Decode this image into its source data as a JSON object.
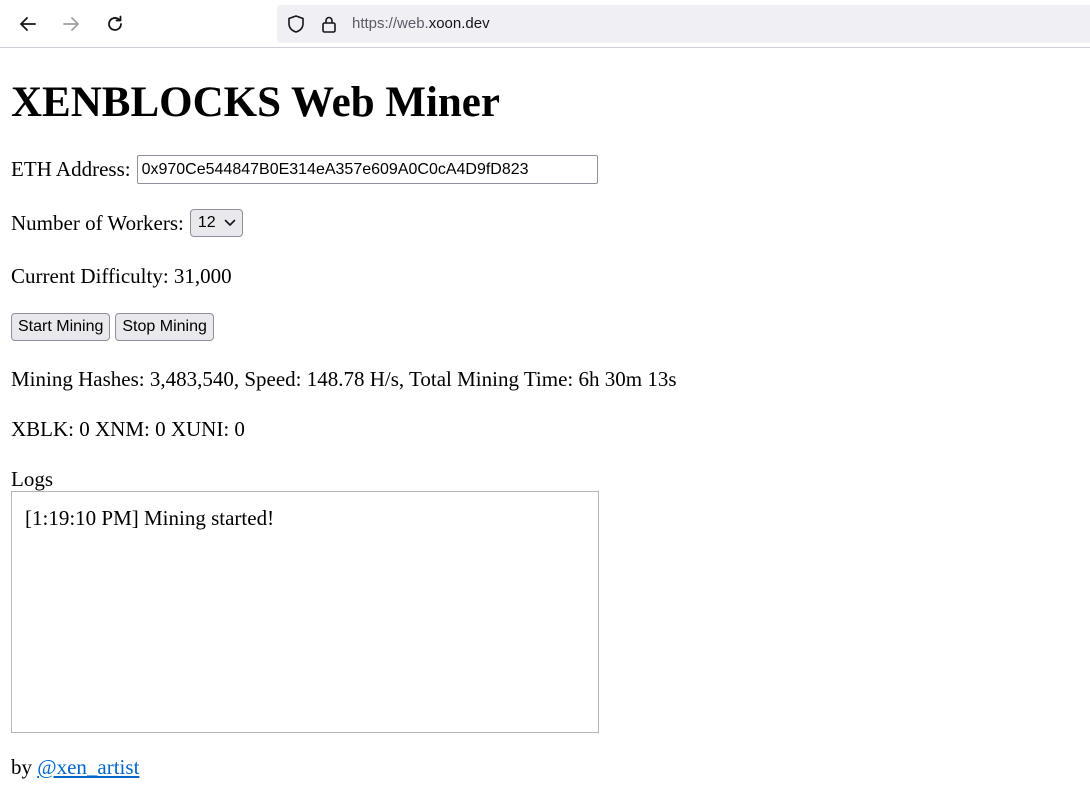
{
  "browser": {
    "url_prefix": "https://web.",
    "url_host": "xoon.dev"
  },
  "page": {
    "title": "XENBLOCKS Web Miner",
    "eth_label": "ETH Address:",
    "eth_value": "0x970Ce544847B0E314eA357e609A0C0cA4D9fD823",
    "workers_label": "Number of Workers:",
    "workers_value": "12",
    "difficulty_text": "Current Difficulty: 31,000",
    "start_button": "Start Mining",
    "stop_button": "Stop Mining",
    "stats_text": "Mining Hashes: 3,483,540, Speed: 148.78 H/s, Total Mining Time: 6h 30m 13s",
    "tokens_text": "XBLK: 0 XNM: 0 XUNI: 0",
    "logs_label": "Logs",
    "logs": [
      "[1:19:10 PM] Mining started!"
    ],
    "footer_by": "by",
    "footer_link": "@xen_artist"
  },
  "colors": {
    "link": "#0066cc",
    "button_bg": "#e9e9ed",
    "urlbar_bg": "#f0f0f4"
  }
}
